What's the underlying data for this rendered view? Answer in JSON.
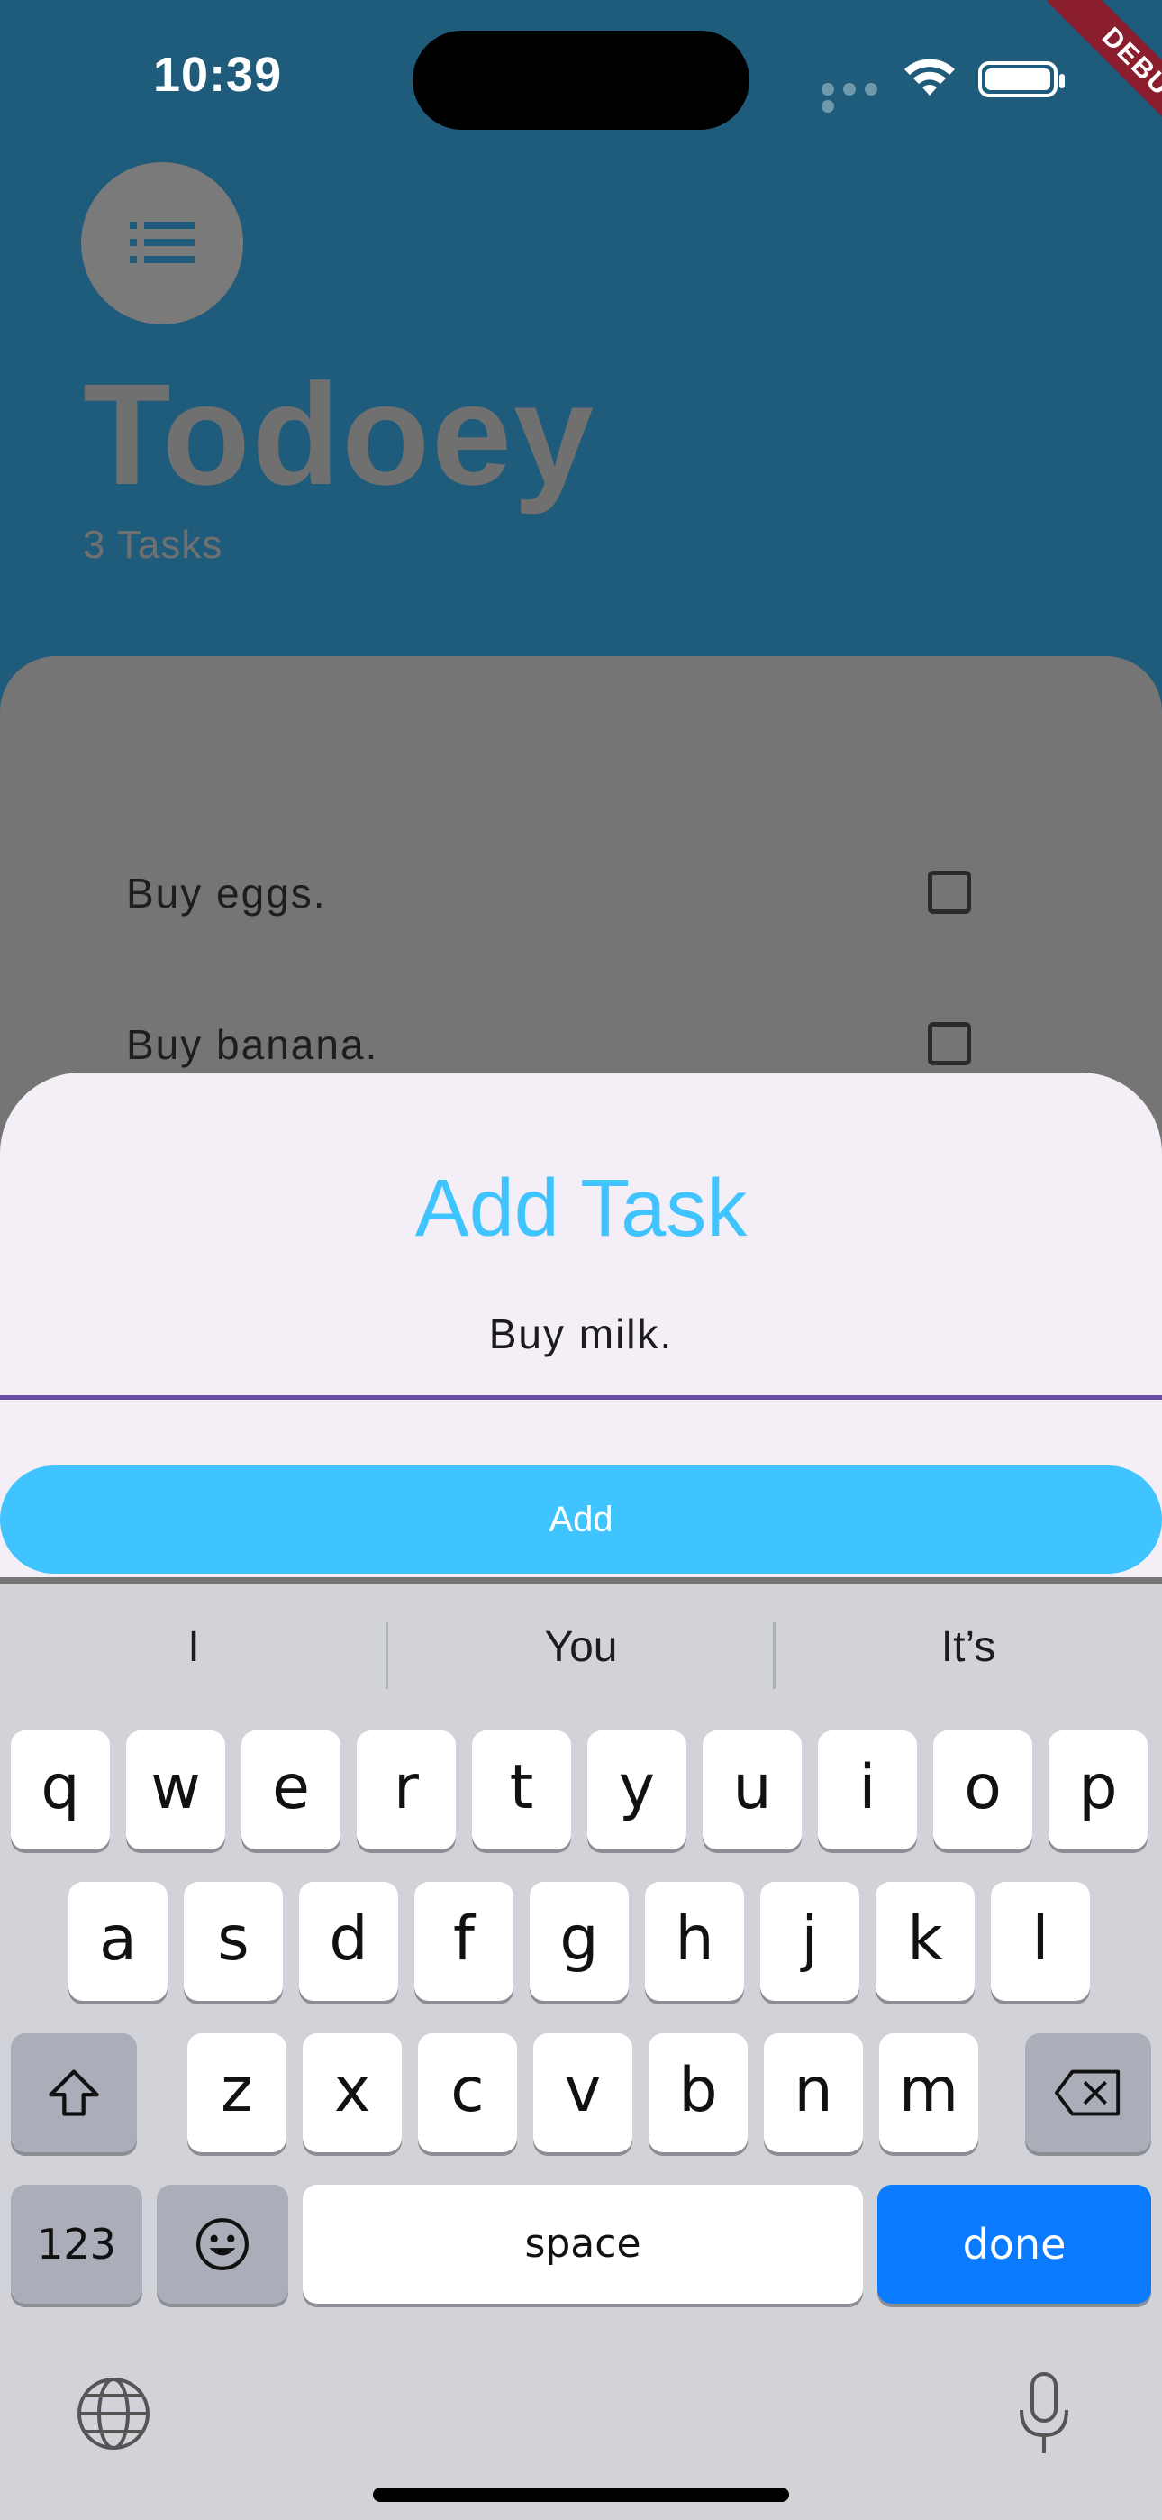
{
  "status_bar": {
    "time": "10:39"
  },
  "debug_banner": "DEBUG",
  "app": {
    "title": "Todoey",
    "task_count": "3 Tasks",
    "tasks": [
      {
        "label": "Buy eggs.",
        "checked": false
      },
      {
        "label": "Buy banana.",
        "checked": false
      }
    ]
  },
  "sheet": {
    "title": "Add Task",
    "input_value": "Buy milk.",
    "add_button": "Add"
  },
  "keyboard": {
    "suggestions": [
      "I",
      "You",
      "It’s"
    ],
    "row1": [
      "q",
      "w",
      "e",
      "r",
      "t",
      "y",
      "u",
      "i",
      "o",
      "p"
    ],
    "row2": [
      "a",
      "s",
      "d",
      "f",
      "g",
      "h",
      "j",
      "k",
      "l"
    ],
    "row3": [
      "z",
      "x",
      "c",
      "v",
      "b",
      "n",
      "m"
    ],
    "numbers_key": "123",
    "space_key": "space",
    "done_key": "done"
  },
  "colors": {
    "accent": "#40c4ff",
    "underline": "#6750a4",
    "done_key": "#0a7aff",
    "background": "#1f5b7a"
  }
}
